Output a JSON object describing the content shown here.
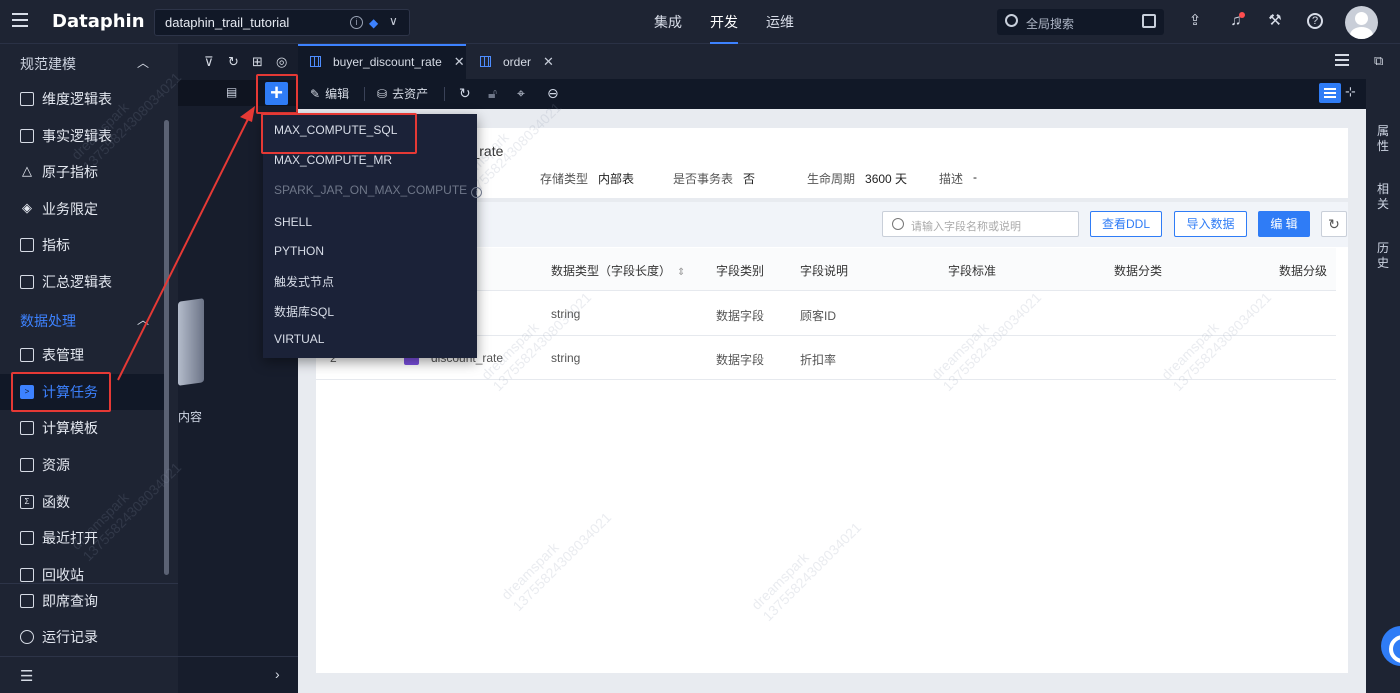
{
  "app": {
    "logo": "Dataphin",
    "project": "dataphin_trail_tutorial",
    "nav": [
      "集成",
      "开发",
      "运维"
    ],
    "active_nav": "开发",
    "search_placeholder": "全局搜索"
  },
  "sidebar": {
    "group1": "规范建模",
    "group1_items": [
      "维度逻辑表",
      "事实逻辑表",
      "原子指标",
      "业务限定",
      "指标",
      "汇总逻辑表"
    ],
    "group2": "数据处理",
    "group2_items": [
      "表管理",
      "计算任务",
      "计算模板",
      "资源",
      "函数",
      "最近打开",
      "回收站"
    ],
    "bottom_items": [
      "即席查询",
      "运行记录"
    ],
    "active_item": "计算任务"
  },
  "panel2": {
    "empty_text": "内容"
  },
  "tabs": [
    {
      "label": "buyer_discount_rate",
      "active": true
    },
    {
      "label": "order",
      "active": false
    }
  ],
  "toolbar": {
    "edit": "编辑",
    "to_asset": "去资产"
  },
  "dropdown": {
    "items": [
      {
        "label": "MAX_COMPUTE_SQL",
        "disabled": false
      },
      {
        "label": "MAX_COMPUTE_MR",
        "disabled": false
      },
      {
        "label": "SPARK_JAR_ON_MAX_COMPUTE",
        "disabled": true
      },
      {
        "label": "SHELL",
        "disabled": false
      },
      {
        "label": "PYTHON",
        "disabled": false
      },
      {
        "label": "触发式节点",
        "disabled": false
      },
      {
        "label": "数据库SQL",
        "disabled": false
      },
      {
        "label": "VIRTUAL",
        "disabled": false
      }
    ]
  },
  "table_info": {
    "title_fragment": "unt_rate",
    "storage_type_label": "存储类型",
    "storage_type": "内部表",
    "transactional_label": "是否事务表",
    "transactional": "否",
    "lifecycle_label": "生命周期",
    "lifecycle": "3600 天",
    "desc_label": "描述",
    "desc": "-"
  },
  "fields": {
    "search_placeholder": "请输入字段名称或说明",
    "btn_view_ddl": "查看DDL",
    "btn_import": "导入数据",
    "btn_edit": "编 辑",
    "headers": [
      "数据类型（字段长度）",
      "字段类别",
      "字段说明",
      "字段标准",
      "数据分类",
      "数据分级"
    ],
    "rows": [
      {
        "index": "",
        "name": "",
        "type": "string",
        "category": "数据字段",
        "desc": "顾客ID"
      },
      {
        "index": "2",
        "name": "discount_rate",
        "type": "string",
        "category": "数据字段",
        "desc": "折扣率"
      }
    ]
  },
  "right_rail": [
    "属性",
    "相关",
    "历史"
  ],
  "watermark": {
    "line1": "dreamspark",
    "line2": "13755824308034021"
  },
  "colors": {
    "accent": "#2f7cf6",
    "highlight": "#e53935"
  }
}
